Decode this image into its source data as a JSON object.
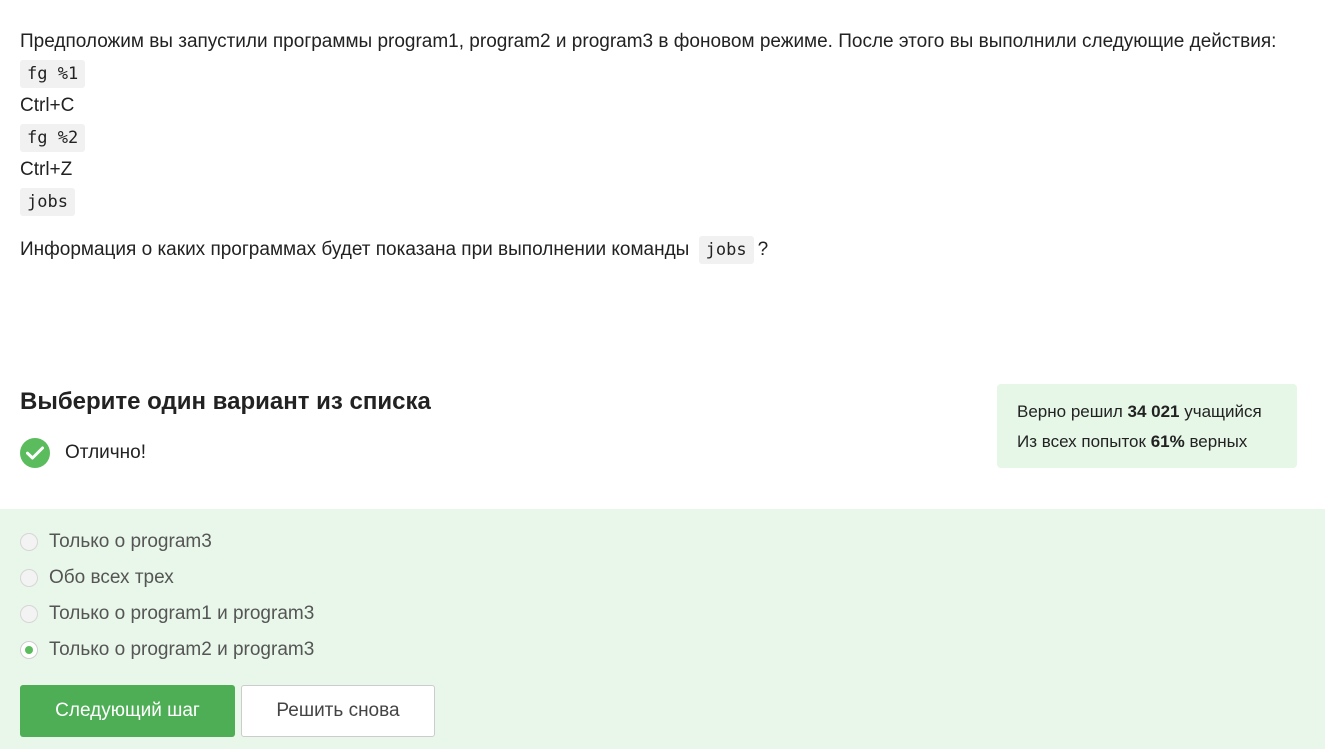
{
  "question": {
    "intro": "Предположим вы запустили программы program1, program2 и program3 в фоновом режиме. После этого вы выполнили следующие действия:",
    "steps": [
      "fg %1",
      "Ctrl+C",
      "fg %2",
      "Ctrl+Z",
      "jobs"
    ],
    "prompt_before": "Информация о каких программах будет показана при выполнении команды",
    "prompt_code": "jobs",
    "prompt_after": "?"
  },
  "choose_title": "Выберите один вариант из списка",
  "result": {
    "text": "Отлично!",
    "icon": "checkmark-circle-icon",
    "color": "#5bbc5e"
  },
  "stats": {
    "line1_prefix": "Верно решил",
    "line1_value": "34 021",
    "line1_suffix": "учащийся",
    "line2_prefix": "Из всех попыток",
    "line2_value": "61%",
    "line2_suffix": "верных"
  },
  "options": [
    {
      "label": "Только о program3",
      "selected": false
    },
    {
      "label": "Обо всех трех",
      "selected": false
    },
    {
      "label": "Только о program1 и program3",
      "selected": false
    },
    {
      "label": "Только о program2 и program3",
      "selected": true
    }
  ],
  "buttons": {
    "next": "Следующий шаг",
    "retry": "Решить снова"
  },
  "colors": {
    "accent": "#4eae55",
    "options_bg": "#e8f7e9",
    "stats_bg": "#e6f6e7"
  }
}
